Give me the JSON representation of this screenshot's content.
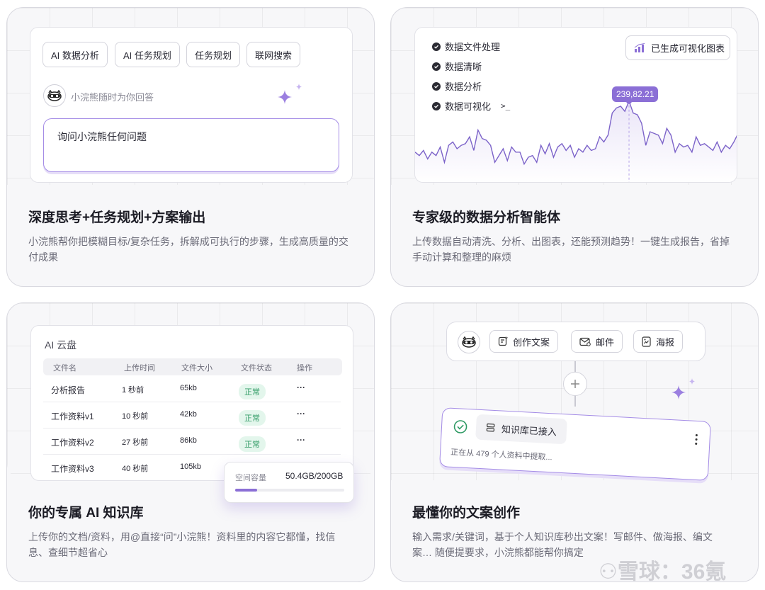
{
  "cards": [
    {
      "title": "深度思考+任务规划+方案输出",
      "desc": "小浣熊帮你把模糊目标/复杂任务，拆解成可执行的步骤，生成高质量的交付成果"
    },
    {
      "title": "专家级的数据分析智能体",
      "desc": "上传数据自动清洗、分析、出图表，还能预测趋势！一键生成报告，省掉手动计算和整理的麻烦"
    },
    {
      "title": "你的专属 AI 知识库",
      "desc": "上传你的文档/资料，用@直接“问”小浣熊！资料里的内容它都懂，找信息、查细节超省心"
    },
    {
      "title": "最懂你的文案创作",
      "desc": "输入需求/关键词，基于个人知识库秒出文案！写邮件、做海报、编文案… 随便提要求，小浣熊都能帮你搞定"
    }
  ],
  "chat": {
    "chips": [
      "AI 数据分析",
      "AI 任务规划",
      "任务规划",
      "联网搜索"
    ],
    "hint": "小浣熊随时为你回答",
    "input_text": "询问小浣熊任何问题"
  },
  "analysis": {
    "steps": [
      "数据文件处理",
      "数据清晰",
      "数据分析",
      "数据可视化"
    ],
    "prompt_symbol": ">_",
    "chart_button": "已生成可视化图表",
    "tooltip": "239,82.21"
  },
  "chart_data": {
    "type": "line",
    "title": "",
    "xlabel": "",
    "ylabel": "",
    "series": [
      {
        "values": [
          8,
          6,
          9,
          4,
          8,
          6,
          11,
          2,
          12,
          14,
          10,
          12,
          13,
          17,
          9,
          21,
          16,
          15,
          12,
          2,
          6,
          10,
          3,
          11,
          8,
          8,
          1,
          5,
          6,
          2,
          12,
          7,
          13,
          5,
          11,
          13,
          9,
          12,
          5,
          10,
          8,
          12,
          9,
          10,
          17,
          14,
          18,
          31,
          34,
          35,
          32,
          38,
          31,
          30,
          25,
          12,
          20,
          19,
          18,
          13,
          22,
          18,
          8,
          13,
          11,
          12,
          8,
          17,
          12,
          13,
          11,
          9,
          14,
          8,
          12,
          10,
          14,
          19
        ]
      }
    ],
    "highlight_index": 51,
    "grid": false,
    "legend": "none"
  },
  "kb": {
    "title": "AI 云盘",
    "columns": [
      "文件名",
      "上传时间",
      "文件大小",
      "文件状态",
      "操作"
    ],
    "rows": [
      {
        "name": "分析报告",
        "time": "1 秒前",
        "size": "65kb",
        "status": "正常",
        "op": "···"
      },
      {
        "name": "工作资料v1",
        "time": "10 秒前",
        "size": "42kb",
        "status": "正常",
        "op": "···"
      },
      {
        "name": "工作资料v2",
        "time": "27 秒前",
        "size": "86kb",
        "status": "正常",
        "op": "···"
      },
      {
        "name": "工作资料v3",
        "time": "40 秒前",
        "size": "105kb"
      }
    ],
    "capacity_label": "空间容量",
    "capacity_value": "50.4GB/200GB",
    "capacity_fraction": 0.2
  },
  "writing": {
    "tools": [
      "创作文案",
      "邮件",
      "海报"
    ],
    "kb_status": "知识库已接入",
    "progress_text": "正在从 479 个人资料中提取..."
  },
  "watermark": "雪球：36氪",
  "colors": {
    "accent": "#8b6fd6",
    "success": "#2f9a64"
  }
}
